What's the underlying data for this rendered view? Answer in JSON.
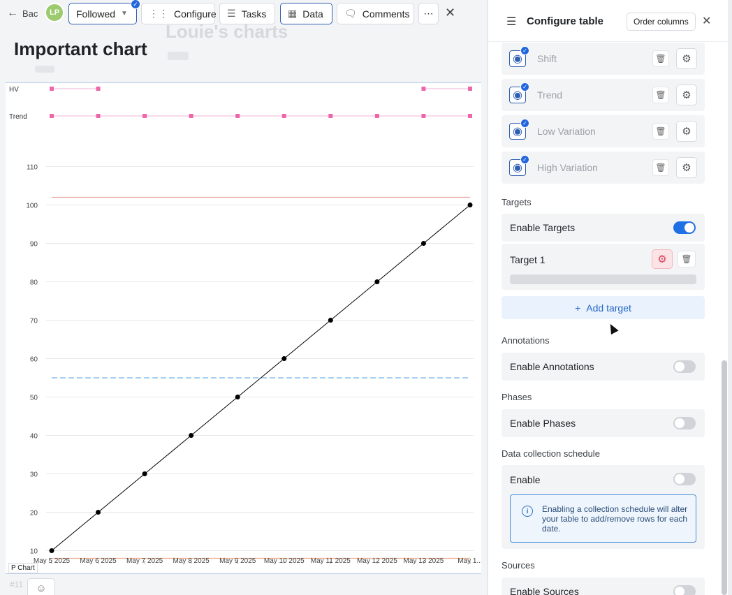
{
  "toolbar": {
    "back_label": "Bac",
    "avatar_initials": "LP",
    "followed_label": "Followed",
    "configure_label": "Configure",
    "tasks_label": "Tasks",
    "data_label": "Data",
    "comments_label": "Comments",
    "more_label": "⋯"
  },
  "background": {
    "ghost_title": "Louie's charts",
    "ghost_row": "#11"
  },
  "page_title": "Important chart",
  "chart_footer_label": "P Chart",
  "chart_data": {
    "type": "line",
    "x": [
      "May 5 2025",
      "May 6 2025",
      "May 7 2025",
      "May 8 2025",
      "May 9 2025",
      "May 10 2025",
      "May 11 2025",
      "May 12 2025",
      "May 13 2025",
      "May 1..."
    ],
    "series": [
      {
        "values": [
          10,
          20,
          30,
          40,
          50,
          60,
          70,
          80,
          90,
          100
        ],
        "color": "#000000"
      }
    ],
    "yticks": [
      10,
      20,
      30,
      40,
      50,
      60,
      70,
      80,
      90,
      100,
      110
    ],
    "ylim": [
      7,
      119
    ],
    "reference_lines": [
      {
        "value": 102,
        "color": "#e8a0a0",
        "style": "solid"
      },
      {
        "value": 55,
        "color": "#6fb0e8",
        "style": "dashed"
      },
      {
        "value": 8,
        "color": "#f0b090",
        "style": "solid"
      }
    ],
    "marker_rows": [
      {
        "label": "HV",
        "color": "#ee66aa",
        "points": [
          0,
          1,
          8,
          9
        ],
        "segments": [
          [
            0,
            1
          ],
          [
            8,
            9
          ]
        ]
      },
      {
        "label": "Trend",
        "color": "#ee66aa",
        "points": [
          0,
          1,
          2,
          3,
          4,
          5,
          6,
          7,
          8,
          9
        ],
        "segments": [
          [
            0,
            9
          ]
        ]
      }
    ]
  },
  "panel": {
    "title": "Configure table",
    "order_columns_label": "Order columns",
    "columns": [
      {
        "label": "Shift"
      },
      {
        "label": "Trend"
      },
      {
        "label": "Low Variation"
      },
      {
        "label": "High Variation"
      }
    ],
    "targets": {
      "section_label": "Targets",
      "enable_label": "Enable Targets",
      "enabled": true,
      "items": [
        {
          "name": "Target 1"
        }
      ],
      "add_label": "Add target"
    },
    "annotations": {
      "section_label": "Annotations",
      "enable_label": "Enable Annotations",
      "enabled": false
    },
    "phases": {
      "section_label": "Phases",
      "enable_label": "Enable Phases",
      "enabled": false
    },
    "schedule": {
      "section_label": "Data collection schedule",
      "enable_label": "Enable",
      "enabled": false,
      "info_text": "Enabling a collection schedule will alter your table to add/remove rows for each date."
    },
    "sources": {
      "section_label": "Sources",
      "enable_label": "Enable Sources",
      "enabled": false
    }
  }
}
